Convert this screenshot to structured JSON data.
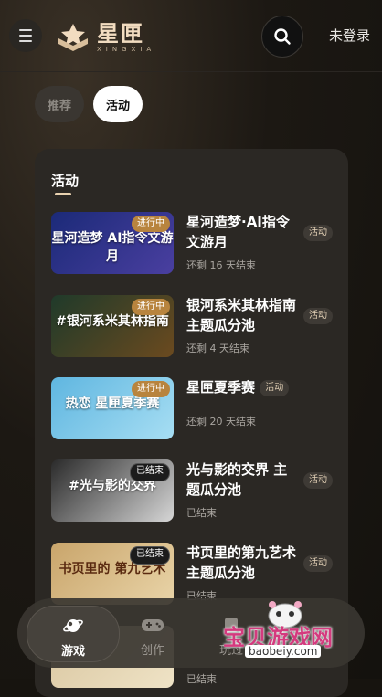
{
  "header": {
    "logo_main": "星匣",
    "logo_sub": "XINGXIA",
    "login_label": "未登录"
  },
  "tabs": [
    {
      "label": "推荐",
      "active": false
    },
    {
      "label": "活动",
      "active": true
    }
  ],
  "panel": {
    "title": "活动",
    "items": [
      {
        "title": "星河造梦·AI指令文游月",
        "tag": "活动",
        "status_badge": "进行中",
        "subtitle": "还剩 16 天结束",
        "thumb_text": "星河造梦 AI指令文游月",
        "thumb_colors": [
          "#1b2a78",
          "#4a3fa0"
        ]
      },
      {
        "title": "银河系米其林指南 主题瓜分池",
        "tag": "活动",
        "status_badge": "进行中",
        "subtitle": "还剩 4 天结束",
        "thumb_text": "#银河系米其林指南",
        "thumb_colors": [
          "#1f3a2a",
          "#6b4a1f"
        ]
      },
      {
        "title": "星匣夏季赛",
        "tag": "活动",
        "status_badge": "进行中",
        "subtitle": "还剩 20 天结束",
        "thumb_text": "热恋 星匣夏季赛",
        "thumb_colors": [
          "#5fb6e0",
          "#a7def3"
        ]
      },
      {
        "title": "光与影的交界 主题瓜分池",
        "tag": "活动",
        "status_badge": "已结束",
        "subtitle": "已结束",
        "thumb_text": "#光与影的交界",
        "thumb_colors": [
          "#2a2a2a",
          "#d6d6d6"
        ]
      },
      {
        "title": "书页里的第九艺术 主题瓜分池",
        "tag": "活动",
        "status_badge": "已结束",
        "subtitle": "已结束",
        "thumb_text": "书页里的 第九艺术",
        "thumb_colors": [
          "#c9a56b",
          "#e9d4a8"
        ]
      },
      {
        "title": "",
        "tag": "",
        "status_badge": "",
        "subtitle": "已结束",
        "thumb_text": "",
        "thumb_colors": [
          "#d9c6a0",
          "#efe3c6"
        ]
      }
    ]
  },
  "bottom_nav": [
    {
      "label": "游戏",
      "icon": "planet-icon",
      "active": true
    },
    {
      "label": "创作",
      "icon": "gamepad-icon",
      "active": false
    },
    {
      "label": "玩过",
      "icon": "history-icon",
      "active": false
    }
  ],
  "watermark": {
    "text": "宝贝游戏网",
    "url": "baobeiy.com"
  },
  "colors": {
    "accent_gold": "#e9d2b0",
    "ongoing_badge": "#b8843e",
    "background": "#17140f"
  }
}
